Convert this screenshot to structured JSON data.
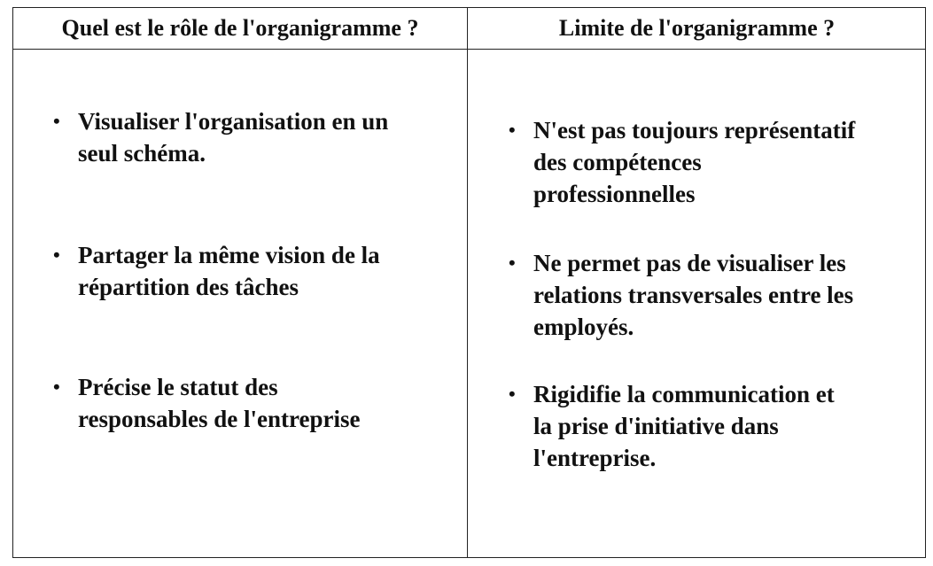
{
  "table": {
    "left_header": "Quel est le rôle de l'organigramme ?",
    "right_header": "Limite de l'organigramme ?",
    "left_items": [
      {
        "line1": "Visualiser l'organisation en un",
        "line2": "seul schéma."
      },
      {
        "line1": "Partager la même vision de la",
        "line2": "répartition des tâches"
      },
      {
        "line1": "Précise le statut des",
        "line2": "responsables de l'entreprise"
      }
    ],
    "right_items": [
      {
        "line1": "N'est pas toujours représentatif",
        "line2": "des compétences",
        "line3": "professionnelles"
      },
      {
        "line1": "Ne permet pas de visualiser les",
        "line2": "relations transversales entre les",
        "line3": "employés."
      },
      {
        "line1": "Rigidifie la communication  et",
        "line2": "la prise d'initiative dans",
        "line3": "l'entreprise."
      }
    ],
    "bullet_symbol": "•"
  }
}
